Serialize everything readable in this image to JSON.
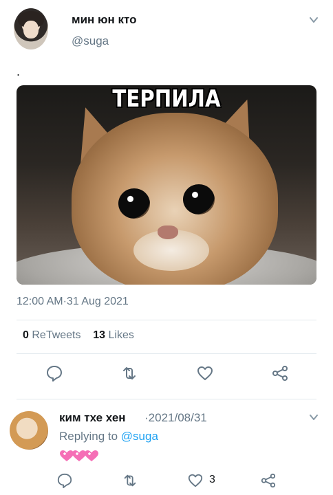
{
  "tweet": {
    "author_name": "мин юн кто",
    "author_handle": "@suga",
    "text": ".",
    "image_caption": "ТЕРПИЛА",
    "timestamp": "12:00 AM·31 Aug 2021",
    "retweets_count": "0",
    "retweets_label": "ReTweets",
    "likes_count": "13",
    "likes_label": "Likes"
  },
  "actions": {
    "icons": [
      "reply-icon",
      "retweet-icon",
      "like-icon",
      "share-icon"
    ]
  },
  "reply": {
    "author_name": "ким тхе хен",
    "date": "·2021/08/31",
    "replying_prefix": "Replying to",
    "replying_handle": "@suga",
    "content_icons": [
      "heart-emoji",
      "heart-emoji",
      "heart-emoji"
    ],
    "like_count": "3"
  },
  "colors": {
    "text": "#14171a",
    "secondary": "#657786",
    "link": "#1da1f2",
    "divider": "#e1e8ed",
    "heart_pink": "#f56fb6"
  }
}
